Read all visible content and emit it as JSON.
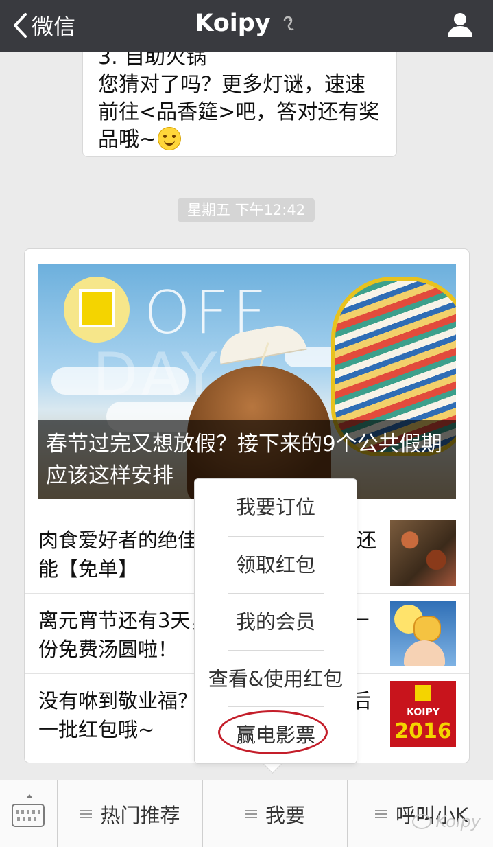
{
  "navbar": {
    "back_label": "微信",
    "title": "Koipy"
  },
  "bubble": {
    "lines": [
      "3. 自助火锅",
      "您猜对了吗？更多灯谜，速速",
      "前往<品香筵>吧，答对还有奖",
      "品哦~"
    ]
  },
  "timestamp": "星期五 下午12:42",
  "card": {
    "cover": {
      "overlay_text": [
        "OFF",
        "DAY"
      ],
      "title": "春节过完又想放假？接下来的9个公共假期应该这样安排"
    },
    "articles": [
      {
        "title": "肉食爱好者的绝佳去处，和好友一起还能【免单】"
      },
      {
        "title": "离元宵节还有3天，来店就可以领取一份免费汤圆啦！"
      },
      {
        "title": "没有咻到敬业福？没关系！Koipy最后一批红包哦~"
      }
    ],
    "thumb3": {
      "brand": "KOIPY",
      "year": "2016"
    }
  },
  "menu": {
    "items": [
      "我要订位",
      "领取红包",
      "我的会员",
      "查看&使用红包",
      "赢电影票"
    ]
  },
  "bottombar": {
    "tabs": [
      "热门推荐",
      "我要",
      "呼叫小K"
    ]
  },
  "watermark": "Koipy"
}
